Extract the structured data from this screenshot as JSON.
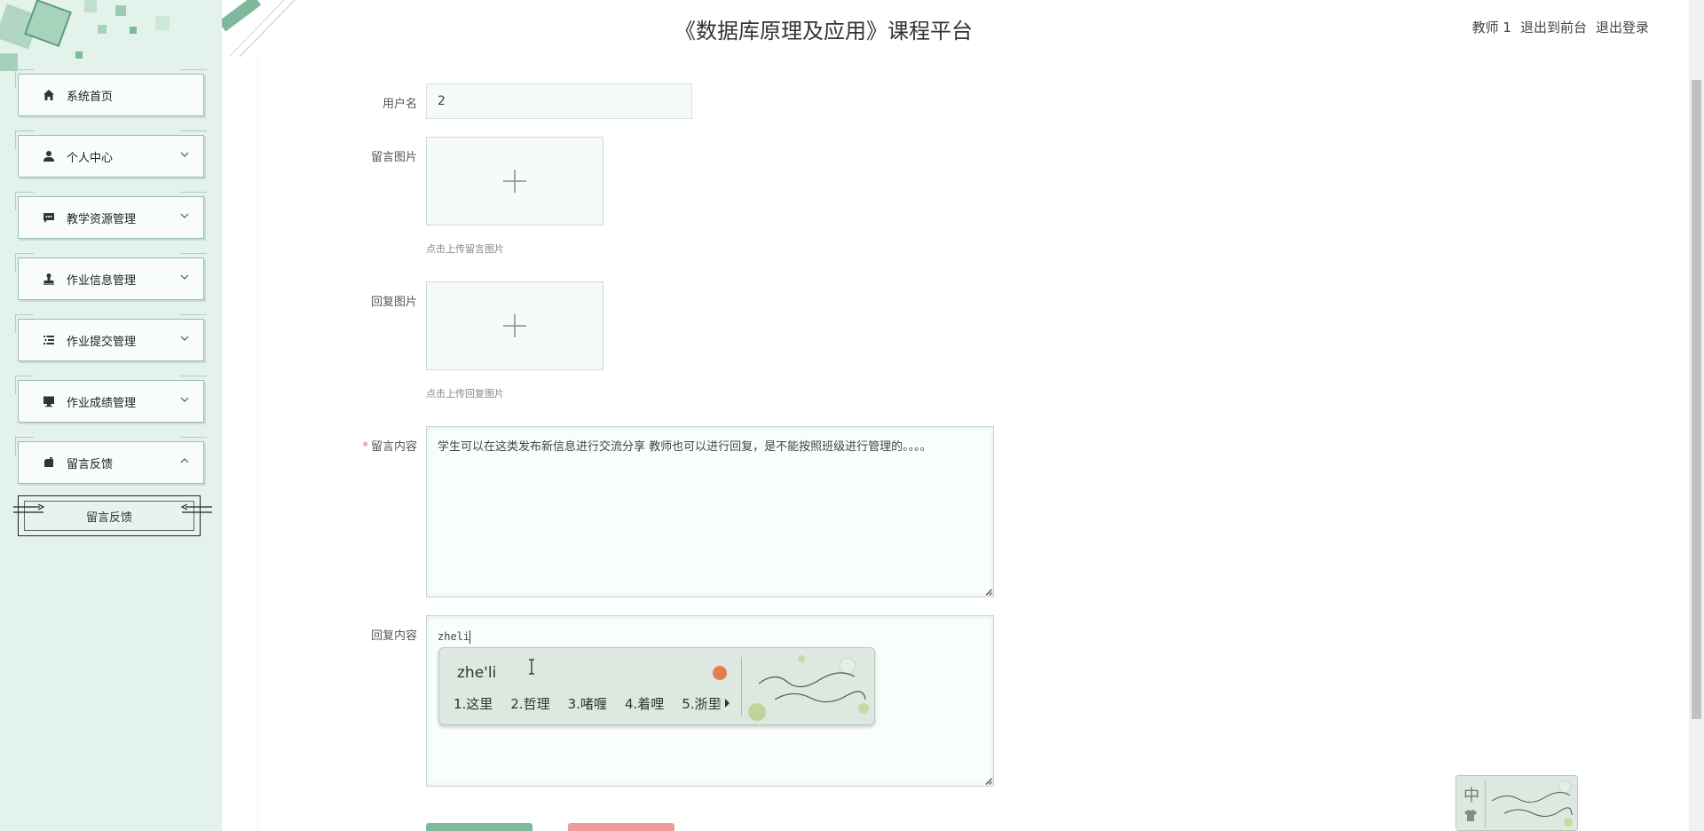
{
  "header": {
    "title": "《数据库原理及应用》课程平台",
    "user": "教师 1",
    "exit_front": "退出到前台",
    "logout": "退出登录"
  },
  "sidebar": {
    "items": [
      {
        "label": "系统首页",
        "icon": "home-icon"
      },
      {
        "label": "个人中心",
        "icon": "person-icon"
      },
      {
        "label": "教学资源管理",
        "icon": "chat-icon"
      },
      {
        "label": "作业信息管理",
        "icon": "stamp-icon"
      },
      {
        "label": "作业提交管理",
        "icon": "list-icon"
      },
      {
        "label": "作业成绩管理",
        "icon": "monitor-icon"
      },
      {
        "label": "留言反馈",
        "icon": "mailbox-icon"
      }
    ],
    "submenu": {
      "label": "留言反馈"
    }
  },
  "form": {
    "username_label": "用户名",
    "username_value": "2",
    "image_label": "留言图片",
    "image_hint": "点击上传留言图片",
    "reply_image_label": "回复图片",
    "reply_image_hint": "点击上传回复图片",
    "content_label": "留言内容",
    "content_required": "*",
    "content_value": "学生可以在这类发布新信息进行交流分享 教师也可以进行回复，是不能按照班级进行管理的。。。。",
    "reply_label": "回复内容",
    "reply_value": "zheli"
  },
  "ime": {
    "input": "zhe'li",
    "candidates": [
      "1.这里",
      "2.哲理",
      "3.啫喱",
      "4.着哩",
      "5.浙里"
    ],
    "status_char": "中"
  },
  "colors": {
    "sidebar_bg": "#e3f2ea",
    "accent_green": "#7fb99c",
    "cancel_red": "#f19a9a"
  }
}
